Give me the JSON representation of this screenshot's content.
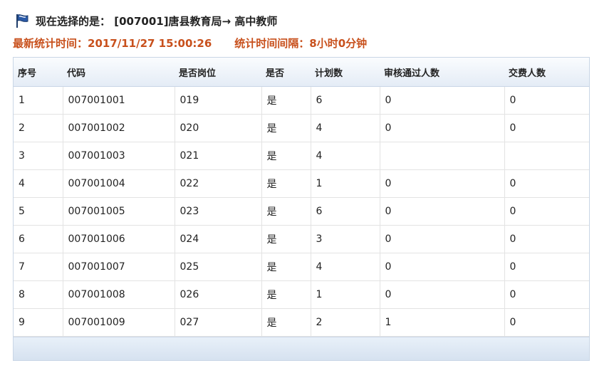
{
  "header": {
    "title": "现在选择的是： [007001]唐县教育局→ 高中教师",
    "flag_icon": "flag-icon"
  },
  "stats": {
    "update_time": "最新统计时间：2017/11/27 15:00:26",
    "interval": "统计时间间隔：8小时0分钟"
  },
  "colors": {
    "accent": "#c8501c",
    "header_bg": "#e4ecf6",
    "border": "#c9d6e6"
  },
  "table": {
    "columns": [
      "序号",
      "代码",
      "是否岗位",
      "是否",
      "计划数",
      "审核通过人数",
      "交费人数"
    ],
    "rows": [
      [
        "1",
        "007001001",
        "019",
        "是",
        "6",
        "0",
        "0"
      ],
      [
        "2",
        "007001002",
        "020",
        "是",
        "4",
        "0",
        "0"
      ],
      [
        "3",
        "007001003",
        "021",
        "是",
        "4",
        "",
        ""
      ],
      [
        "4",
        "007001004",
        "022",
        "是",
        "1",
        "0",
        "0"
      ],
      [
        "5",
        "007001005",
        "023",
        "是",
        "6",
        "0",
        "0"
      ],
      [
        "6",
        "007001006",
        "024",
        "是",
        "3",
        "0",
        "0"
      ],
      [
        "7",
        "007001007",
        "025",
        "是",
        "4",
        "0",
        "0"
      ],
      [
        "8",
        "007001008",
        "026",
        "是",
        "1",
        "0",
        "0"
      ],
      [
        "9",
        "007001009",
        "027",
        "是",
        "2",
        "1",
        "0"
      ]
    ]
  }
}
